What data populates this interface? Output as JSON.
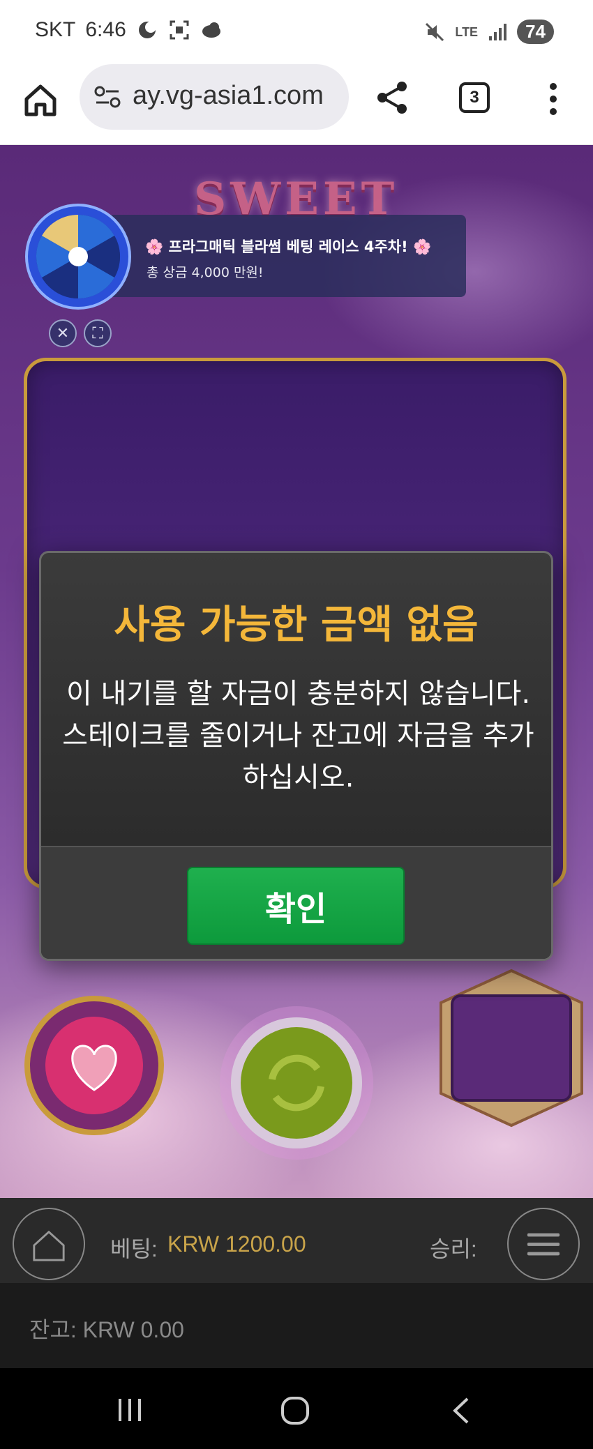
{
  "status_bar": {
    "carrier": "SKT",
    "time": "6:46",
    "lte": "LTE",
    "battery": "74",
    "icons": [
      "moon-icon",
      "screenshot-icon",
      "cloud-icon",
      "mute-icon",
      "signal-icon"
    ]
  },
  "browser": {
    "url": "ay.vg-asia1.com",
    "tab_count": "3",
    "icons": [
      "home-icon",
      "site-settings-icon",
      "share-icon",
      "overflow-menu-icon"
    ]
  },
  "game": {
    "logo_text": "SWEET",
    "promo": {
      "title": "🌸 프라그매틱 블라썸 베팅 레이스 4주차! 🌸",
      "subtitle": "총 상금 4,000 만원!"
    },
    "bottom_bar": {
      "bet_label": "베팅:",
      "bet_value": "KRW 1200.00",
      "win_label": "승리:",
      "balance_label": "잔고: KRW 0.00"
    }
  },
  "modal": {
    "title": "사용 가능한 금액 없음",
    "message": "이 내기를 할 자금이 충분하지 않습니다. 스테이크를 줄이거나 잔고에 자금을 추가하십시오.",
    "ok_label": "확인"
  },
  "colors": {
    "modal_title": "#f4b73a",
    "ok_button": "#1fb04e",
    "bet_value": "#c9a44a",
    "game_bg": "#6b3a8c"
  }
}
